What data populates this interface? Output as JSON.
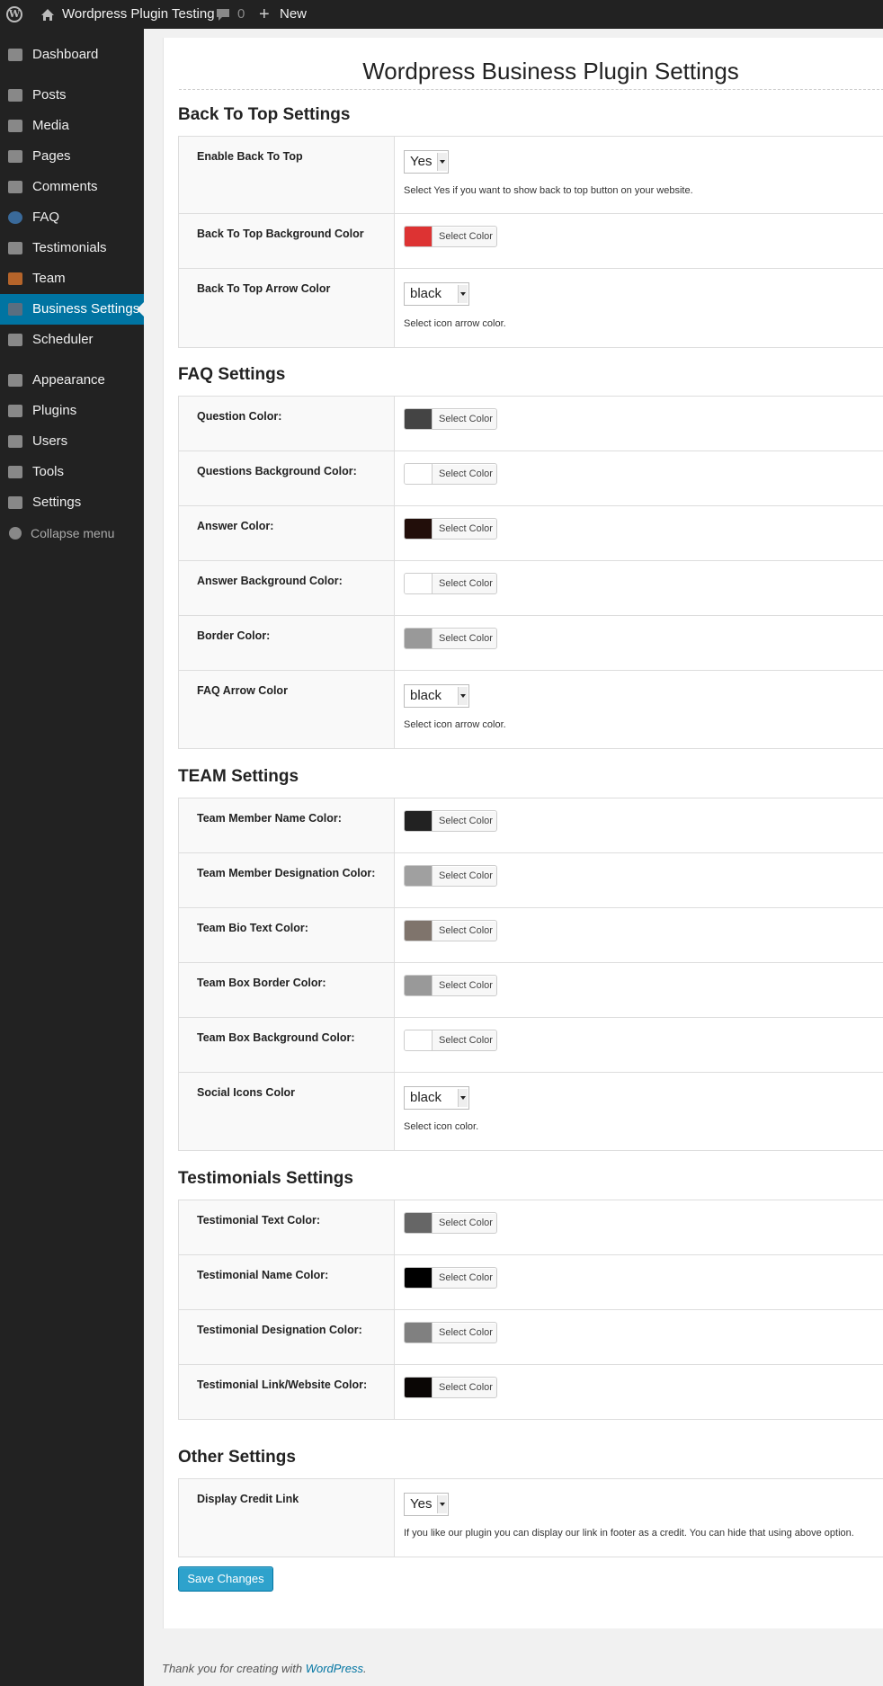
{
  "admin_bar": {
    "site_name": "Wordpress Plugin Testing",
    "comment_count": "0",
    "new_label": "New"
  },
  "sidebar": {
    "items": [
      {
        "label": "Dashboard",
        "icon": "dashboard-icon"
      },
      {
        "label": "Posts",
        "icon": "pin-icon"
      },
      {
        "label": "Media",
        "icon": "media-icon"
      },
      {
        "label": "Pages",
        "icon": "pages-icon"
      },
      {
        "label": "Comments",
        "icon": "comment-icon"
      },
      {
        "label": "FAQ",
        "icon": "faq-icon"
      },
      {
        "label": "Testimonials",
        "icon": "testimonials-icon"
      },
      {
        "label": "Team",
        "icon": "team-icon"
      },
      {
        "label": "Business Settings",
        "icon": "business-settings-icon",
        "current": true
      },
      {
        "label": "Scheduler",
        "icon": "scheduler-icon"
      },
      {
        "label": "Appearance",
        "icon": "brush-icon"
      },
      {
        "label": "Plugins",
        "icon": "plugin-icon"
      },
      {
        "label": "Users",
        "icon": "user-icon"
      },
      {
        "label": "Tools",
        "icon": "wrench-icon"
      },
      {
        "label": "Settings",
        "icon": "settings-icon"
      }
    ],
    "collapse_label": "Collapse menu",
    "accent_color": "#0074a2"
  },
  "page": {
    "title": "Wordpress Business Plugin Settings"
  },
  "common": {
    "select_color_label": "Select Color"
  },
  "sections": {
    "back_to_top": {
      "title": "Back To Top Settings",
      "enable_label": "Enable Back To Top",
      "enable_value": "Yes",
      "enable_desc": "Select Yes if you want to show back to top button on your website.",
      "bg_color_label": "Back To Top Background Color",
      "bg_color": "#dd3333",
      "arrow_color_label": "Back To Top Arrow Color",
      "arrow_color_value": "black",
      "arrow_color_desc": "Select icon arrow color."
    },
    "faq": {
      "title": "FAQ Settings",
      "question_color_label": "Question Color:",
      "question_color": "#444444",
      "question_bg_label": "Questions Background Color:",
      "question_bg": "#ffffff",
      "answer_color_label": "Answer Color:",
      "answer_color": "#220e0a",
      "answer_bg_label": "Answer Background Color:",
      "answer_bg": "#ffffff",
      "border_color_label": "Border Color:",
      "border_color": "#999999",
      "arrow_color_label": "FAQ Arrow Color",
      "arrow_color_value": "black",
      "arrow_color_desc": "Select icon arrow color."
    },
    "team": {
      "title": "TEAM Settings",
      "name_color_label": "Team Member Name Color:",
      "name_color": "#222222",
      "designation_color_label": "Team Member Designation Color:",
      "designation_color": "#a0a0a0",
      "bio_color_label": "Team Bio Text Color:",
      "bio_color": "#7f746c",
      "box_border_label": "Team Box Border Color:",
      "box_border": "#999999",
      "box_bg_label": "Team Box Background Color:",
      "box_bg": "#ffffff",
      "social_color_label": "Social Icons Color",
      "social_color_value": "black",
      "social_color_desc": "Select icon color."
    },
    "testimonials": {
      "title": "Testimonials Settings",
      "text_color_label": "Testimonial Text Color:",
      "text_color": "#666666",
      "name_color_label": "Testimonial Name Color:",
      "name_color": "#000000",
      "designation_color_label": "Testimonial Designation Color:",
      "designation_color": "#808080",
      "link_color_label": "Testimonial Link/Website Color:",
      "link_color": "#0a0605"
    },
    "other": {
      "title": "Other Settings",
      "credit_label": "Display Credit Link",
      "credit_value": "Yes",
      "credit_desc": "If you like our plugin you can display our link in footer as a credit. You can hide that using above option."
    }
  },
  "save_button": "Save Changes",
  "footer": {
    "text": "Thank you for creating with ",
    "link": "WordPress",
    "end": "."
  }
}
